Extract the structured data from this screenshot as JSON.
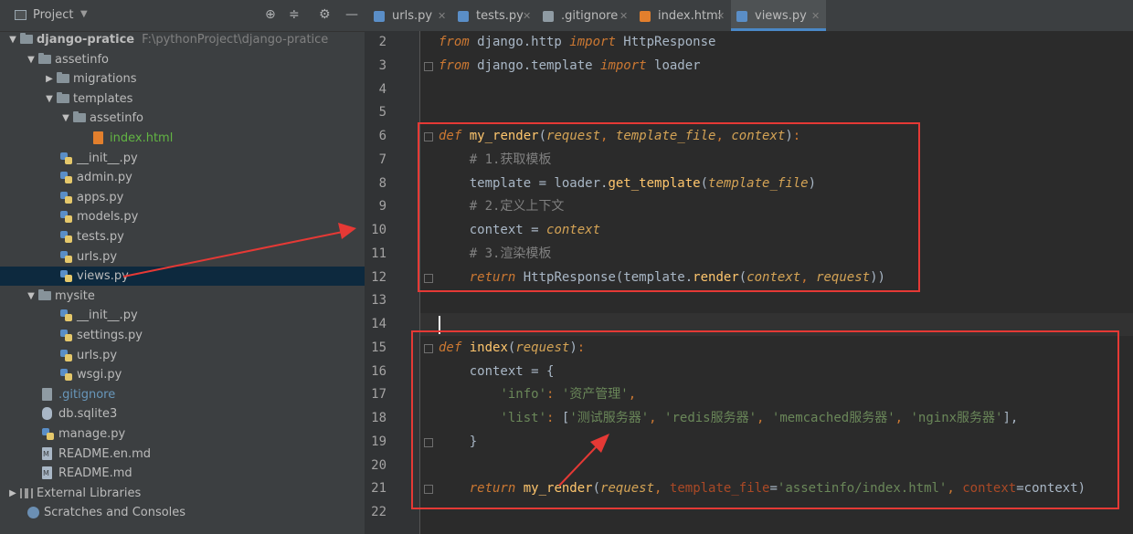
{
  "project_panel": {
    "title": "Project",
    "tree": [
      {
        "label": "django-pratice",
        "path": "F:\\pythonProject\\django-pratice",
        "type": "folder",
        "level": 0,
        "expanded": true
      },
      {
        "label": "assetinfo",
        "type": "folder",
        "level": 1,
        "expanded": true
      },
      {
        "label": "migrations",
        "type": "folder",
        "level": 2,
        "expanded": false
      },
      {
        "label": "templates",
        "type": "folder",
        "level": 2,
        "expanded": true
      },
      {
        "label": "assetinfo",
        "type": "folder",
        "level": 3,
        "expanded": true
      },
      {
        "label": "index.html",
        "type": "html",
        "level": 4
      },
      {
        "label": "__init__.py",
        "type": "py",
        "level": 2
      },
      {
        "label": "admin.py",
        "type": "py",
        "level": 2
      },
      {
        "label": "apps.py",
        "type": "py",
        "level": 2
      },
      {
        "label": "models.py",
        "type": "py",
        "level": 2
      },
      {
        "label": "tests.py",
        "type": "py",
        "level": 2
      },
      {
        "label": "urls.py",
        "type": "py",
        "level": 2
      },
      {
        "label": "views.py",
        "type": "py",
        "level": 2,
        "selected": true
      },
      {
        "label": "mysite",
        "type": "folder",
        "level": 1,
        "expanded": true
      },
      {
        "label": "__init__.py",
        "type": "py",
        "level": 2
      },
      {
        "label": "settings.py",
        "type": "py",
        "level": 2
      },
      {
        "label": "urls.py",
        "type": "py",
        "level": 2
      },
      {
        "label": "wsgi.py",
        "type": "py",
        "level": 2
      },
      {
        "label": ".gitignore",
        "type": "git",
        "level": 1
      },
      {
        "label": "db.sqlite3",
        "type": "db",
        "level": 1
      },
      {
        "label": "manage.py",
        "type": "py",
        "level": 1
      },
      {
        "label": "README.en.md",
        "type": "md",
        "level": 1
      },
      {
        "label": "README.md",
        "type": "md",
        "level": 1
      },
      {
        "label": "External Libraries",
        "type": "lib",
        "level": 0,
        "expanded": false
      },
      {
        "label": "Scratches and Consoles",
        "type": "scratch",
        "level": 0
      }
    ]
  },
  "tabs": [
    {
      "label": "urls.py",
      "icon": "python-file-icon"
    },
    {
      "label": "tests.py",
      "icon": "python-file-icon"
    },
    {
      "label": ".gitignore",
      "icon": "git-file-icon"
    },
    {
      "label": "index.html",
      "icon": "html-file-icon"
    },
    {
      "label": "views.py",
      "icon": "python-file-icon",
      "active": true
    }
  ],
  "editor": {
    "line_numbers": [
      "2",
      "3",
      "4",
      "5",
      "6",
      "7",
      "8",
      "9",
      "10",
      "11",
      "12",
      "13",
      "14",
      "15",
      "16",
      "17",
      "18",
      "19",
      "20",
      "21",
      "22"
    ],
    "lines": [
      [
        [
          "kw",
          "from"
        ],
        [
          "df",
          " django.http "
        ],
        [
          "kw",
          "import"
        ],
        [
          "df",
          " HttpResponse"
        ]
      ],
      [
        [
          "kw",
          "from"
        ],
        [
          "df",
          " django.template "
        ],
        [
          "kw",
          "import"
        ],
        [
          "df",
          " loader"
        ]
      ],
      [],
      [],
      [
        [
          "kw",
          "def"
        ],
        [
          "df",
          " "
        ],
        [
          "fn",
          "my_render"
        ],
        [
          "df",
          "("
        ],
        [
          "param",
          "request"
        ],
        [
          "kwn",
          ", "
        ],
        [
          "param",
          "template_file"
        ],
        [
          "kwn",
          ", "
        ],
        [
          "param",
          "context"
        ],
        [
          "df",
          ")"
        ],
        [
          "kwn",
          ":"
        ]
      ],
      [
        [
          "df",
          "    "
        ],
        [
          "cm",
          "# 1.获取模板"
        ]
      ],
      [
        [
          "df",
          "    template = loader."
        ],
        [
          "fn",
          "get_template"
        ],
        [
          "df",
          "("
        ],
        [
          "param",
          "template_file"
        ],
        [
          "df",
          ")"
        ]
      ],
      [
        [
          "df",
          "    "
        ],
        [
          "cm",
          "# 2.定义上下文"
        ]
      ],
      [
        [
          "df",
          "    context = "
        ],
        [
          "param",
          "context"
        ]
      ],
      [
        [
          "df",
          "    "
        ],
        [
          "cm",
          "# 3.渲染模板"
        ]
      ],
      [
        [
          "df",
          "    "
        ],
        [
          "kw",
          "return"
        ],
        [
          "df",
          " HttpResponse(template."
        ],
        [
          "fn",
          "render"
        ],
        [
          "df",
          "("
        ],
        [
          "param",
          "context"
        ],
        [
          "kwn",
          ", "
        ],
        [
          "param",
          "request"
        ],
        [
          "df",
          "))"
        ]
      ],
      [],
      [],
      [
        [
          "kw",
          "def"
        ],
        [
          "df",
          " "
        ],
        [
          "fn",
          "index"
        ],
        [
          "df",
          "("
        ],
        [
          "param",
          "request"
        ],
        [
          "df",
          ")"
        ],
        [
          "kwn",
          ":"
        ]
      ],
      [
        [
          "df",
          "    context = {"
        ]
      ],
      [
        [
          "df",
          "        "
        ],
        [
          "str",
          "'info'"
        ],
        [
          "kwn",
          ": "
        ],
        [
          "str",
          "'资产管理'"
        ],
        [
          "kwn",
          ","
        ]
      ],
      [
        [
          "df",
          "        "
        ],
        [
          "str",
          "'list'"
        ],
        [
          "kwn",
          ": "
        ],
        [
          "df",
          "["
        ],
        [
          "str",
          "'测试服务器'"
        ],
        [
          "kwn",
          ", "
        ],
        [
          "str",
          "'redis服务器'"
        ],
        [
          "kwn",
          ", "
        ],
        [
          "str",
          "'memcached服务器'"
        ],
        [
          "kwn",
          ", "
        ],
        [
          "str",
          "'nginx服务器'"
        ],
        [
          "df",
          "],"
        ]
      ],
      [
        [
          "df",
          "    }"
        ]
      ],
      [],
      [
        [
          "df",
          "    "
        ],
        [
          "kw",
          "return"
        ],
        [
          "df",
          " "
        ],
        [
          "fn",
          "my_render"
        ],
        [
          "df",
          "("
        ],
        [
          "param",
          "request"
        ],
        [
          "kwn",
          ", "
        ],
        [
          "kwarg",
          "template_file"
        ],
        [
          "df",
          "="
        ],
        [
          "str",
          "'assetinfo/index.html'"
        ],
        [
          "kwn",
          ", "
        ],
        [
          "kwarg",
          "context"
        ],
        [
          "df",
          "=context)"
        ]
      ],
      []
    ]
  },
  "colors": {
    "highlight_box": "#e53935",
    "selection": "#0d293e",
    "accent": "#4a88c7"
  }
}
